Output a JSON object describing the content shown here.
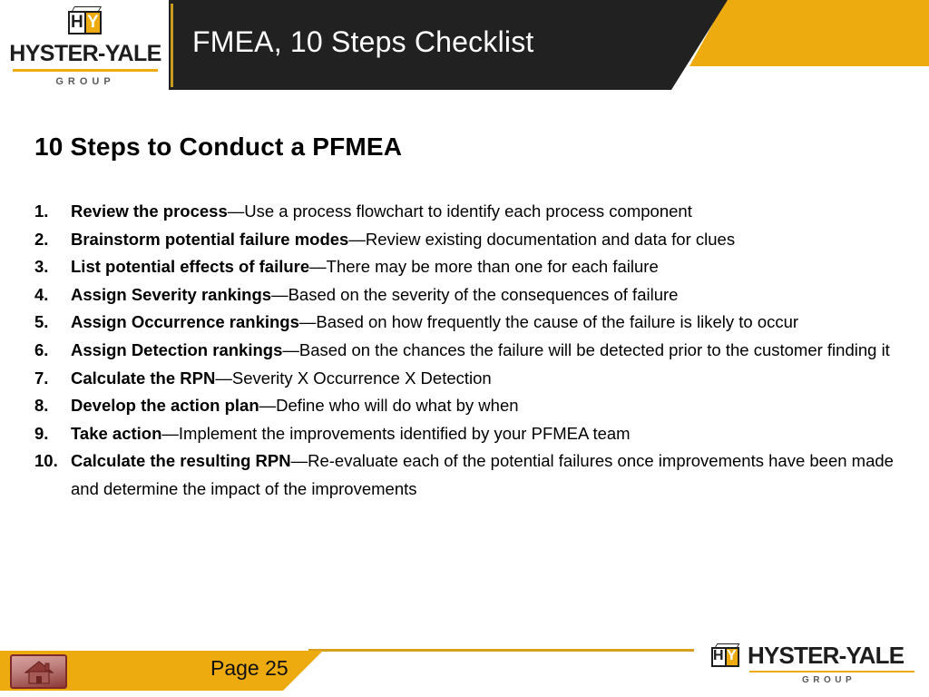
{
  "brand": {
    "company": "HYSTER-YALE",
    "sub": "GROUP",
    "mark_left_letter": "H",
    "mark_right_letter": "Y",
    "accent_yellow": "#eeab10",
    "dark": "#212121"
  },
  "header": {
    "title": "FMEA, 10 Steps Checklist"
  },
  "body": {
    "heading": "10 Steps to Conduct a PFMEA",
    "steps": [
      {
        "num": "1.",
        "term": "Review the process",
        "desc": "—Use a process flowchart to identify each process component"
      },
      {
        "num": "2.",
        "term": "Brainstorm potential failure modes",
        "desc": "—Review existing documentation and data for clues"
      },
      {
        "num": "3.",
        "term": "List potential effects of failure",
        "desc": "—There may be more than one for each failure"
      },
      {
        "num": "4.",
        "term": "Assign Severity rankings",
        "desc": "—Based on the severity of the consequences of failure"
      },
      {
        "num": "5.",
        "term": "Assign Occurrence rankings",
        "desc": "—Based on how frequently the cause of the failure is likely to occur"
      },
      {
        "num": "6.",
        "term": "Assign Detection rankings",
        "desc": "—Based on the chances the failure will be detected prior to the customer finding it"
      },
      {
        "num": "7.",
        "term": "Calculate the RPN",
        "desc": "—Severity X Occurrence X Detection"
      },
      {
        "num": "8.",
        "term": "Develop the action plan",
        "desc": "—Define who will do what by when"
      },
      {
        "num": "9.",
        "term": "Take action",
        "desc": "—Implement the improvements identified by your PFMEA team"
      },
      {
        "num": "10.",
        "term": "Calculate the resulting RPN",
        "desc": "—Re-evaluate each of the potential failures once improvements have been made and determine the impact of the improvements"
      }
    ]
  },
  "footer": {
    "page_label": "Page 25",
    "home_icon": "home-icon"
  }
}
